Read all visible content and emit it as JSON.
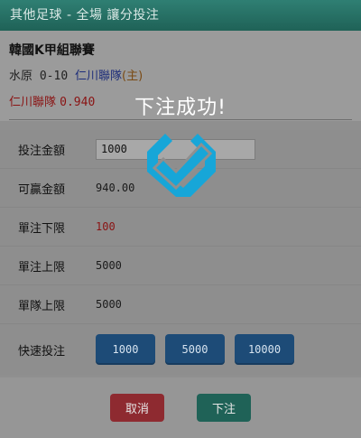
{
  "header": {
    "title": "其他足球 - 全場 讓分投注"
  },
  "match": {
    "league": "韓國K甲組聯賽",
    "home_team": "水原",
    "handicap": "0-10",
    "away_team": "仁川聯隊",
    "home_marker": "(主)",
    "selected_team": "仁川聯隊",
    "odds": "0.940"
  },
  "form": {
    "amount_label": "投注金額",
    "amount_value": "1000",
    "win_label": "可贏金額",
    "win_value": "940.00",
    "min_label": "單注下限",
    "min_value": "100",
    "max_label": "單注上限",
    "max_value": "5000",
    "team_max_label": "單隊上限",
    "team_max_value": "5000",
    "quick_label": "快速投注",
    "quick_options": [
      "1000",
      "5000",
      "10000"
    ]
  },
  "actions": {
    "cancel": "取消",
    "submit": "下注"
  },
  "overlay": {
    "message": "下注成功!",
    "icon": "check-icon"
  },
  "colors": {
    "header": "#1f6257",
    "quick_button": "#1d4b77",
    "cancel": "#8e2a30",
    "submit": "#1f6257",
    "icon": "#17a6d8"
  }
}
